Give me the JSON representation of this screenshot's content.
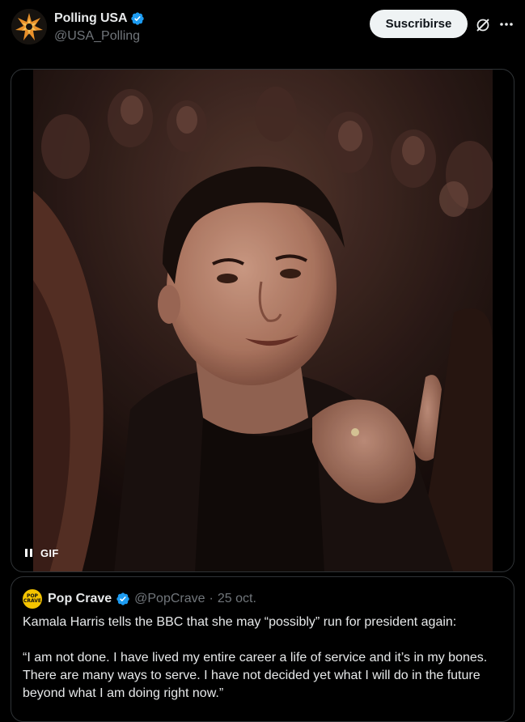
{
  "tweet": {
    "author": {
      "display_name": "Polling USA",
      "handle": "@USA_Polling",
      "verified": true,
      "avatar_icon": "polling-usa-logo"
    },
    "subscribe_label": "Suscribirse",
    "grok_icon": "grok-icon",
    "more_icon": "more-horizontal-icon"
  },
  "media": {
    "type": "gif",
    "badge_label": "GIF",
    "pause_icon": "pause-icon"
  },
  "quote": {
    "author": {
      "display_name": "Pop Crave",
      "handle": "@PopCrave",
      "verified": true,
      "avatar_text": "POP CRAVE"
    },
    "separator": "·",
    "date": "25 oct.",
    "text": "Kamala Harris tells the BBC that she may “possibly” run for president again:\n\n“I am not done. I have lived my entire career a life of service and it’s in my bones. There are many ways to serve. I have not decided yet what I will do in the future beyond what I am doing right now.”"
  },
  "colors": {
    "background": "#000000",
    "text_primary": "#e7e9ea",
    "text_secondary": "#71767b",
    "border": "#2f3336",
    "verified_blue": "#1d9bf0",
    "button_bg": "#eff3f4"
  }
}
